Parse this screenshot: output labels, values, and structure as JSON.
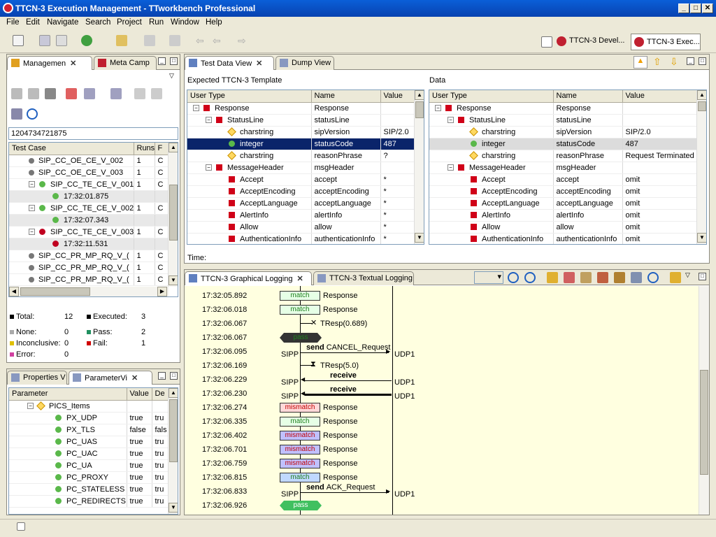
{
  "window": {
    "title": "TTCN-3 Execution Management - TTworkbench Professional"
  },
  "menu": [
    "File",
    "Edit",
    "Navigate",
    "Search",
    "Project",
    "Run",
    "Window",
    "Help"
  ],
  "perspectives": [
    {
      "label": "TTCN-3 Devel..."
    },
    {
      "label": "TTCN-3 Exec..."
    }
  ],
  "mgmt": {
    "tabs": [
      {
        "label": "Managemen"
      },
      {
        "label": "Meta Camp"
      }
    ],
    "campaign_id": "1204734721875",
    "columns": [
      "Test Case",
      "Runs",
      "F"
    ],
    "rows": [
      {
        "name": "SIP_CC_OE_CE_V_002",
        "runs": "1",
        "f": "C",
        "kind": "dot",
        "indent": 0
      },
      {
        "name": "SIP_CC_OE_CE_V_003",
        "runs": "1",
        "f": "C",
        "kind": "dot",
        "indent": 0
      },
      {
        "name": "SIP_CC_TE_CE_V_001",
        "runs": "1",
        "f": "C",
        "kind": "pass",
        "indent": 0
      },
      {
        "name": "17:32:01.875",
        "runs": "",
        "f": "",
        "kind": "passrun",
        "indent": 1
      },
      {
        "name": "SIP_CC_TE_CE_V_002",
        "runs": "1",
        "f": "C",
        "kind": "pass",
        "indent": 0
      },
      {
        "name": "17:32:07.343",
        "runs": "",
        "f": "",
        "kind": "passrun",
        "indent": 1
      },
      {
        "name": "SIP_CC_TE_CE_V_003",
        "runs": "1",
        "f": "C",
        "kind": "fail",
        "indent": 0
      },
      {
        "name": "17:32:11.531",
        "runs": "",
        "f": "",
        "kind": "failrun",
        "indent": 1
      },
      {
        "name": "SIP_CC_PR_MP_RQ_V_(",
        "runs": "1",
        "f": "C",
        "kind": "dot",
        "indent": 0
      },
      {
        "name": "SIP_CC_PR_MP_RQ_V_(",
        "runs": "1",
        "f": "C",
        "kind": "dot",
        "indent": 0
      },
      {
        "name": "SIP_CC_PR_MP_RQ_V_(",
        "runs": "1",
        "f": "C",
        "kind": "dot",
        "indent": 0
      }
    ],
    "stats": {
      "total_label": "Total:",
      "total": "12",
      "executed_label": "Executed:",
      "executed": "3",
      "none_label": "None:",
      "none": "0",
      "pass_label": "Pass:",
      "pass": "2",
      "inconclusive_label": "Inconclusive:",
      "inconclusive": "0",
      "fail_label": "Fail:",
      "fail": "1",
      "error_label": "Error:",
      "error": "0"
    }
  },
  "props": {
    "tabs": [
      {
        "label": "Properties V"
      },
      {
        "label": "ParameterVi"
      }
    ],
    "columns": [
      "Parameter",
      "Value",
      "De"
    ],
    "rows": [
      {
        "name": "PICS_Items",
        "value": "",
        "de": "",
        "group": true
      },
      {
        "name": "PX_UDP",
        "value": "true",
        "de": "tru"
      },
      {
        "name": "PX_TLS",
        "value": "false",
        "de": "fals"
      },
      {
        "name": "PC_UAS",
        "value": "true",
        "de": "tru"
      },
      {
        "name": "PC_UAC",
        "value": "true",
        "de": "tru"
      },
      {
        "name": "PC_UA",
        "value": "true",
        "de": "tru"
      },
      {
        "name": "PC_PROXY",
        "value": "true",
        "de": "tru"
      },
      {
        "name": "PC_STATELESS",
        "value": "true",
        "de": "tru"
      },
      {
        "name": "PC_REDIRECTS",
        "value": "true",
        "de": "tru"
      }
    ]
  },
  "testdata": {
    "tabs": [
      {
        "label": "Test Data View"
      },
      {
        "label": "Dump View"
      }
    ],
    "expected_title": "Expected TTCN-3 Template",
    "data_title": "Data",
    "columns": [
      "User Type",
      "Name",
      "Value"
    ],
    "time_label": "Time:",
    "expected": [
      {
        "type": "Response",
        "name": "Response",
        "value": "",
        "icon": "ri",
        "lvl": 0,
        "tog": "-"
      },
      {
        "type": "StatusLine",
        "name": "statusLine",
        "value": "",
        "icon": "ri",
        "lvl": 1,
        "tog": "-"
      },
      {
        "type": "charstring",
        "name": "sipVersion",
        "value": "SIP/2.0",
        "icon": "oi",
        "lvl": 2
      },
      {
        "type": "integer",
        "name": "statusCode",
        "value": "487",
        "icon": "gi",
        "lvl": 2,
        "sel": true
      },
      {
        "type": "charstring",
        "name": "reasonPhrase",
        "value": "?",
        "icon": "oi",
        "lvl": 2
      },
      {
        "type": "MessageHeader",
        "name": "msgHeader",
        "value": "",
        "icon": "ri",
        "lvl": 1,
        "tog": "-"
      },
      {
        "type": "Accept",
        "name": "accept",
        "value": "*",
        "icon": "ri",
        "lvl": 2
      },
      {
        "type": "AcceptEncoding",
        "name": "acceptEncoding",
        "value": "*",
        "icon": "ri",
        "lvl": 2
      },
      {
        "type": "AcceptLanguage",
        "name": "acceptLanguage",
        "value": "*",
        "icon": "ri",
        "lvl": 2
      },
      {
        "type": "AlertInfo",
        "name": "alertInfo",
        "value": "*",
        "icon": "ri",
        "lvl": 2
      },
      {
        "type": "Allow",
        "name": "allow",
        "value": "*",
        "icon": "ri",
        "lvl": 2
      },
      {
        "type": "AuthenticationInfo",
        "name": "authenticationInfo",
        "value": "*",
        "icon": "ri",
        "lvl": 2
      }
    ],
    "data": [
      {
        "type": "Response",
        "name": "Response",
        "value": "",
        "icon": "ri",
        "lvl": 0,
        "tog": "-"
      },
      {
        "type": "StatusLine",
        "name": "statusLine",
        "value": "",
        "icon": "ri",
        "lvl": 1,
        "tog": "-"
      },
      {
        "type": "charstring",
        "name": "sipVersion",
        "value": "SIP/2.0",
        "icon": "oi",
        "lvl": 2
      },
      {
        "type": "integer",
        "name": "statusCode",
        "value": "487",
        "icon": "gi",
        "lvl": 2,
        "grey": true
      },
      {
        "type": "charstring",
        "name": "reasonPhrase",
        "value": "Request Terminated",
        "icon": "oi",
        "lvl": 2
      },
      {
        "type": "MessageHeader",
        "name": "msgHeader",
        "value": "",
        "icon": "ri",
        "lvl": 1,
        "tog": "-"
      },
      {
        "type": "Accept",
        "name": "accept",
        "value": "omit",
        "icon": "ri",
        "lvl": 2
      },
      {
        "type": "AcceptEncoding",
        "name": "acceptEncoding",
        "value": "omit",
        "icon": "ri",
        "lvl": 2
      },
      {
        "type": "AcceptLanguage",
        "name": "acceptLanguage",
        "value": "omit",
        "icon": "ri",
        "lvl": 2
      },
      {
        "type": "AlertInfo",
        "name": "alertInfo",
        "value": "omit",
        "icon": "ri",
        "lvl": 2
      },
      {
        "type": "Allow",
        "name": "allow",
        "value": "omit",
        "icon": "ri",
        "lvl": 2
      },
      {
        "type": "AuthenticationInfo",
        "name": "authenticationInfo",
        "value": "omit",
        "icon": "ri",
        "lvl": 2
      }
    ]
  },
  "logging": {
    "tabs": [
      {
        "label": "TTCN-3 Graphical Logging"
      },
      {
        "label": "TTCN-3 Textual Logging"
      }
    ],
    "sipp": "SIPP",
    "udp": "UDP1",
    "rows": [
      {
        "time": "17:32:05.892",
        "kind": "match",
        "text": "match",
        "label": "Response"
      },
      {
        "time": "17:32:06.018",
        "kind": "match",
        "text": "match",
        "label": "Response"
      },
      {
        "time": "17:32:06.067",
        "kind": "timer",
        "text": "",
        "label": "TResp(0.689)"
      },
      {
        "time": "17:32:06.067",
        "kind": "verdict",
        "text": "pass",
        "label": ""
      },
      {
        "time": "17:32:06.095",
        "kind": "send",
        "text": "send",
        "label": "CANCEL_Request"
      },
      {
        "time": "17:32:06.169",
        "kind": "timerstart",
        "text": "",
        "label": "TResp(5.0)"
      },
      {
        "time": "17:32:06.229",
        "kind": "receive",
        "text": "receive",
        "label": ""
      },
      {
        "time": "17:32:06.230",
        "kind": "receivebold",
        "text": "receive",
        "label": ""
      },
      {
        "time": "17:32:06.274",
        "kind": "mm",
        "text": "mismatch",
        "label": "Response"
      },
      {
        "time": "17:32:06.335",
        "kind": "match",
        "text": "match",
        "label": "Response"
      },
      {
        "time": "17:32:06.402",
        "kind": "mmb",
        "text": "mismatch",
        "label": "Response"
      },
      {
        "time": "17:32:06.701",
        "kind": "mmb",
        "text": "mismatch",
        "label": "Response"
      },
      {
        "time": "17:32:06.759",
        "kind": "mmb",
        "text": "mismatch",
        "label": "Response"
      },
      {
        "time": "17:32:06.815",
        "kind": "mb",
        "text": "match",
        "label": "Response"
      },
      {
        "time": "17:32:06.833",
        "kind": "send",
        "text": "send",
        "label": "ACK_Request"
      },
      {
        "time": "17:32:06.926",
        "kind": "verdictfinal",
        "text": "pass",
        "label": ""
      }
    ]
  }
}
